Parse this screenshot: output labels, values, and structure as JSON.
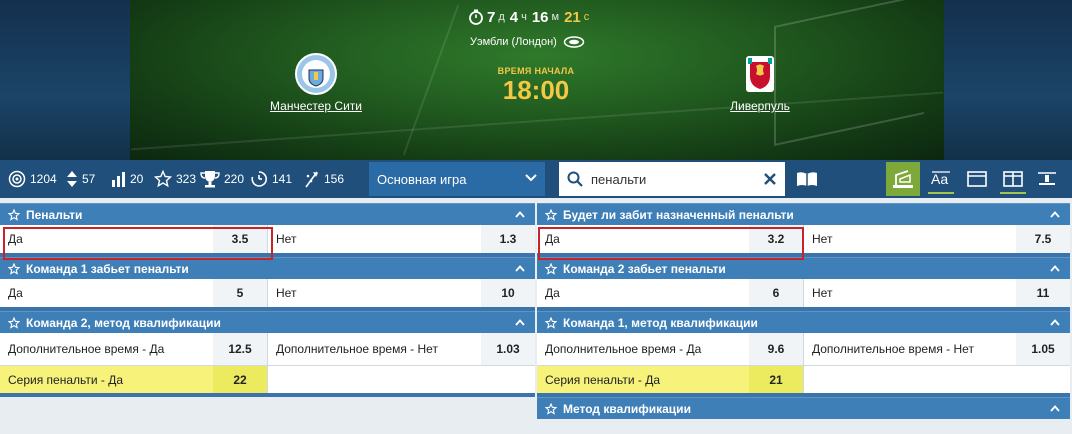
{
  "match": {
    "timer": {
      "days": "7",
      "days_unit": "д",
      "hours": "4",
      "hours_unit": "ч",
      "minutes": "16",
      "minutes_unit": "м",
      "seconds": "21",
      "seconds_unit": "с"
    },
    "venue": "Уэмбли (Лондон)",
    "home_team": "Манчестер Сити",
    "away_team": "Ливерпуль",
    "start_label": "ВРЕМЯ НАЧАЛА",
    "start_time": "18:00"
  },
  "toolbar": {
    "stats": [
      {
        "icon": "target-icon",
        "value": "1204"
      },
      {
        "icon": "updown-icon",
        "value": "57"
      },
      {
        "icon": "bars-icon",
        "value": "20"
      },
      {
        "icon": "star-icon",
        "value": "323"
      },
      {
        "icon": "trophy-icon",
        "value": "220"
      },
      {
        "icon": "stopwatch-icon",
        "value": "141"
      },
      {
        "icon": "flag-icon",
        "value": "156"
      }
    ],
    "game_select": "Основная игра",
    "search_value": "пенальти"
  },
  "markets": {
    "left": [
      {
        "title": "Пенальти",
        "outcomes": [
          {
            "label": "Да",
            "odd": "3.5"
          },
          {
            "label": "Нет",
            "odd": "1.3"
          }
        ]
      },
      {
        "title": "Команда 1 забьет пенальти",
        "outcomes": [
          {
            "label": "Да",
            "odd": "5"
          },
          {
            "label": "Нет",
            "odd": "10"
          }
        ]
      },
      {
        "title": "Команда 2, метод квалификации",
        "outcomes": [
          {
            "label": "Дополнительное время - Да",
            "odd": "12.5"
          },
          {
            "label": "Дополнительное время - Нет",
            "odd": "1.03"
          },
          {
            "label": "Серия пенальти - Да",
            "odd": "22"
          }
        ]
      }
    ],
    "right": [
      {
        "title": "Будет ли забит назначенный пенальти",
        "outcomes": [
          {
            "label": "Да",
            "odd": "3.2"
          },
          {
            "label": "Нет",
            "odd": "7.5"
          }
        ]
      },
      {
        "title": "Команда 2 забьет пенальти",
        "outcomes": [
          {
            "label": "Да",
            "odd": "6"
          },
          {
            "label": "Нет",
            "odd": "11"
          }
        ]
      },
      {
        "title": "Команда 1, метод квалификации",
        "outcomes": [
          {
            "label": "Дополнительное время - Да",
            "odd": "9.6"
          },
          {
            "label": "Дополнительное время - Нет",
            "odd": "1.05"
          },
          {
            "label": "Серия пенальти - Да",
            "odd": "21"
          }
        ]
      },
      {
        "title": "Метод квалификации"
      }
    ]
  },
  "colors": {
    "header_bar": "#1f4f7a",
    "market_header": "#3f7fb8",
    "highlight_red": "#c9232a",
    "accent_yellow": "#f3c844",
    "highlight_yellow": "#f7f27a"
  }
}
